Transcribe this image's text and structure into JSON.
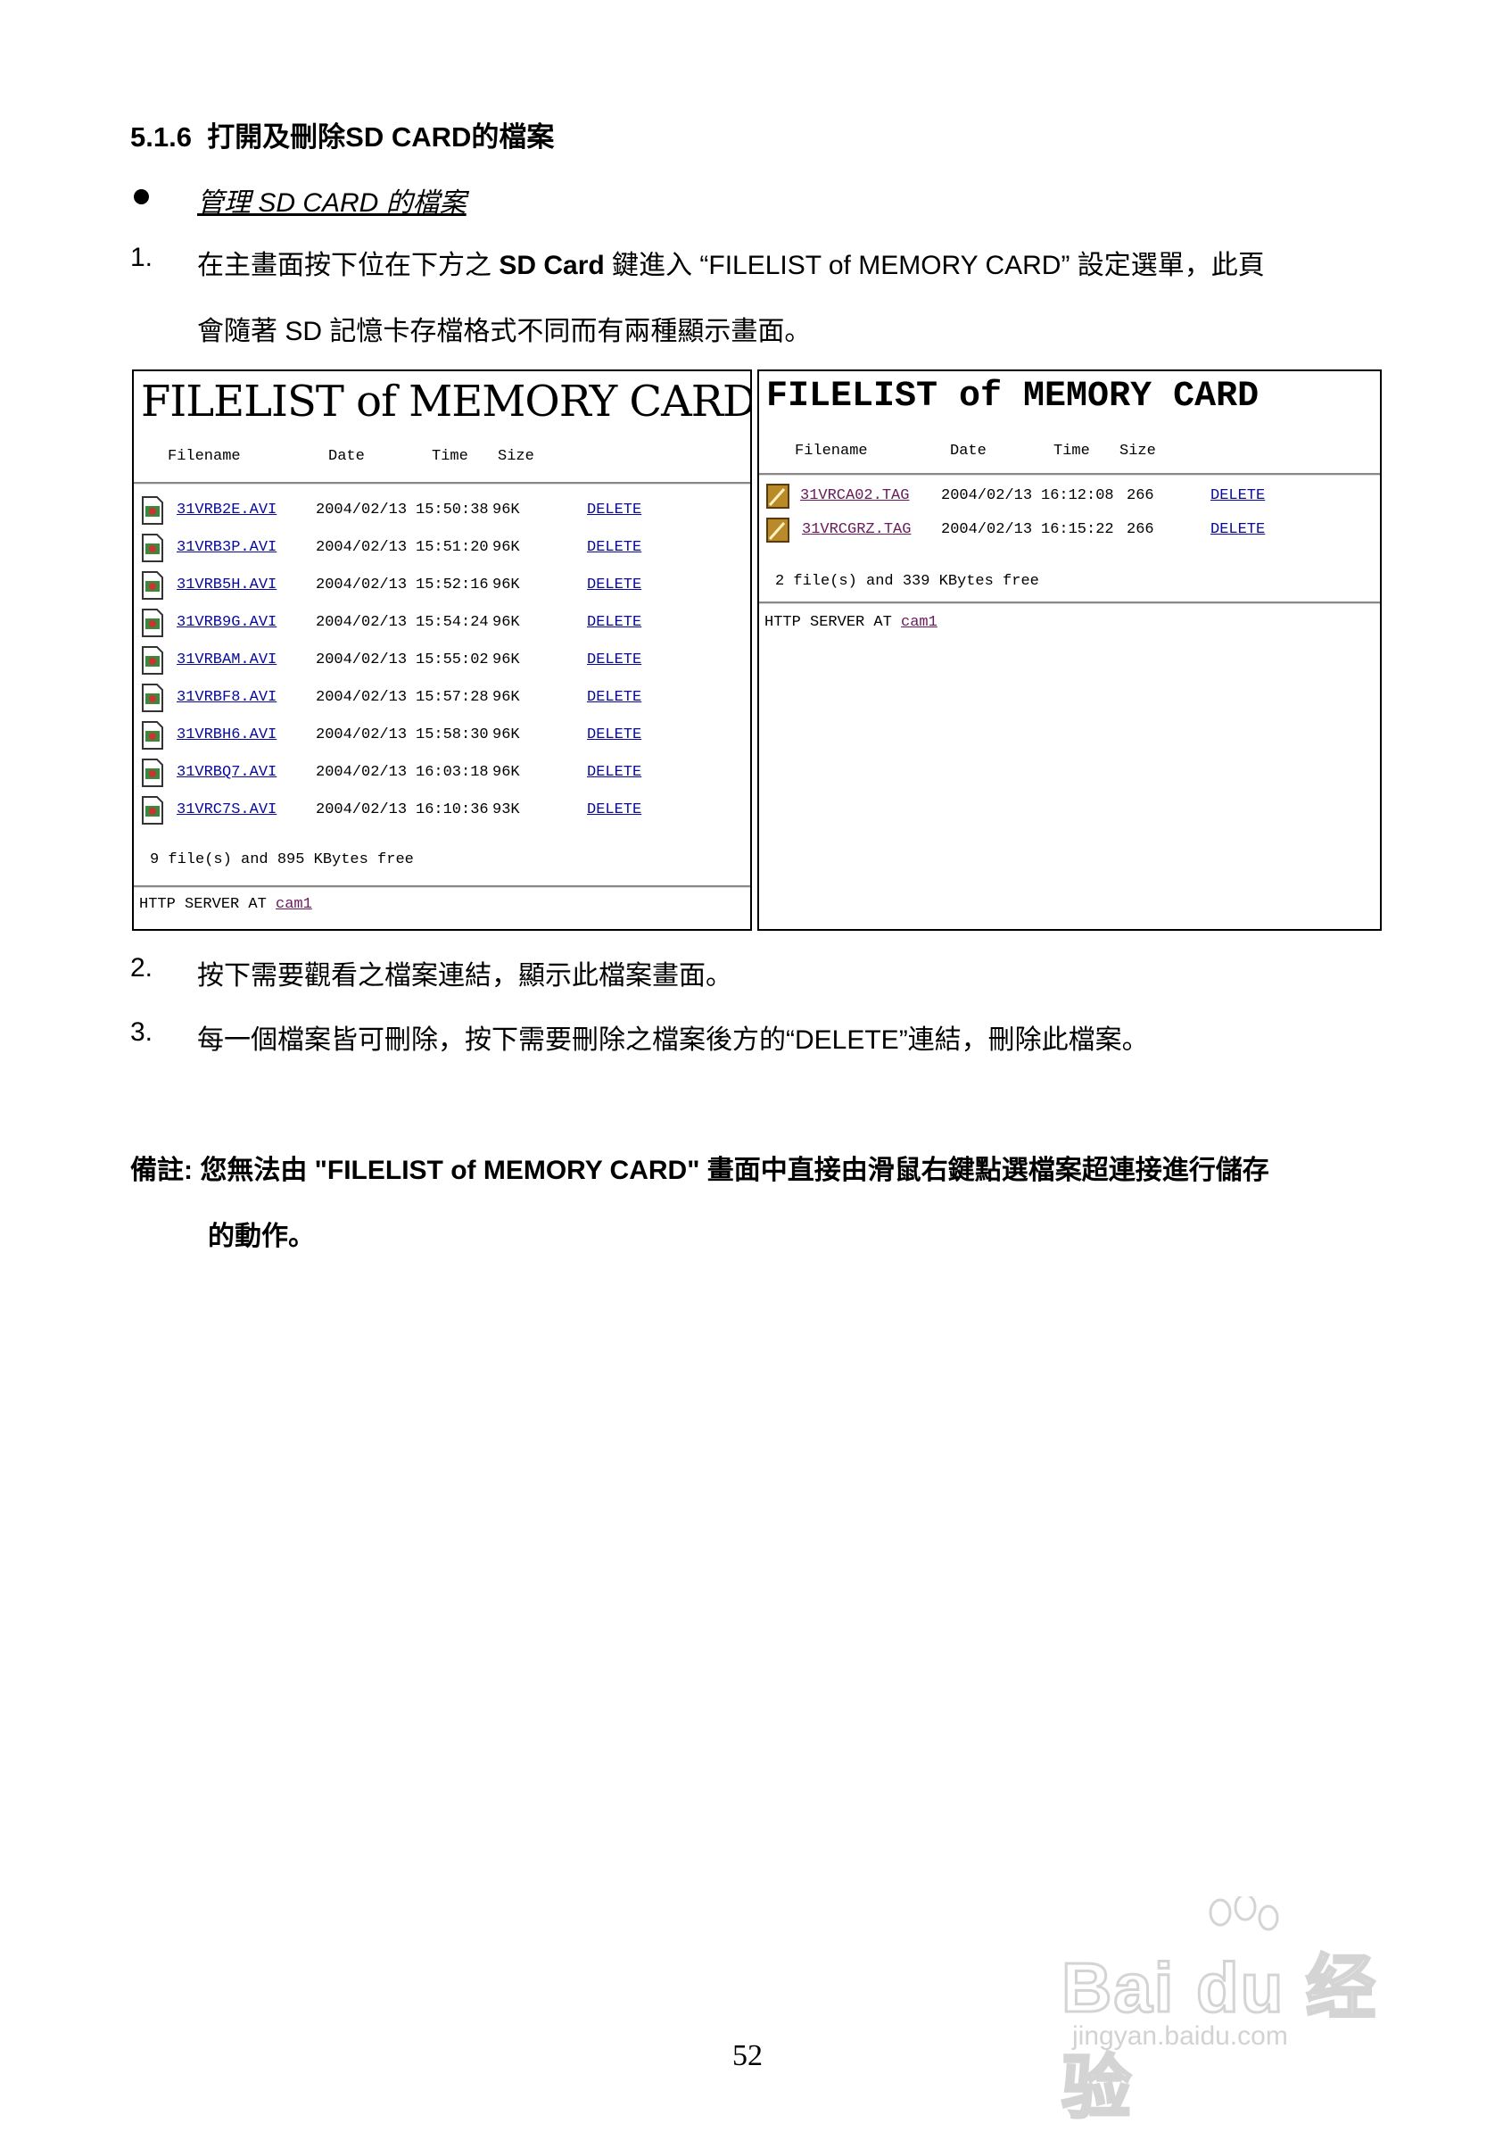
{
  "section": {
    "number": "5.1.6",
    "title": "打開及刪除SD CARD的檔案"
  },
  "bullet": "管理 SD CARD 的檔案",
  "steps": [
    {
      "num": "1.",
      "pre": "在主畫面按下位在下方之 ",
      "bold": "SD Card",
      "post": " 鍵進入 “FILELIST of MEMORY CARD” 設定選單，此頁",
      "line2": "會隨著 SD 記憶卡存檔格式不同而有兩種顯示畫面。"
    },
    {
      "num": "2.",
      "text": "按下需要觀看之檔案連結，顯示此檔案畫面。"
    },
    {
      "num": "3.",
      "text": "每一個檔案皆可刪除，按下需要刪除之檔案後方的“DELETE”連結，刪除此檔案。"
    }
  ],
  "panel_left": {
    "title": "FILELIST of MEMORY CARD",
    "headers": {
      "filename": "Filename",
      "date": "Date",
      "time": "Time",
      "size": "Size"
    },
    "rows": [
      {
        "name": "31VRB2E.AVI",
        "date": "2004/02/13",
        "time": "15:50:38",
        "size": "96K",
        "action": "DELETE"
      },
      {
        "name": "31VRB3P.AVI",
        "date": "2004/02/13",
        "time": "15:51:20",
        "size": "96K",
        "action": "DELETE"
      },
      {
        "name": "31VRB5H.AVI",
        "date": "2004/02/13",
        "time": "15:52:16",
        "size": "96K",
        "action": "DELETE"
      },
      {
        "name": "31VRB9G.AVI",
        "date": "2004/02/13",
        "time": "15:54:24",
        "size": "96K",
        "action": "DELETE"
      },
      {
        "name": "31VRBAM.AVI",
        "date": "2004/02/13",
        "time": "15:55:02",
        "size": "96K",
        "action": "DELETE"
      },
      {
        "name": "31VRBF8.AVI",
        "date": "2004/02/13",
        "time": "15:57:28",
        "size": "96K",
        "action": "DELETE"
      },
      {
        "name": "31VRBH6.AVI",
        "date": "2004/02/13",
        "time": "15:58:30",
        "size": "96K",
        "action": "DELETE"
      },
      {
        "name": "31VRBQ7.AVI",
        "date": "2004/02/13",
        "time": "16:03:18",
        "size": "96K",
        "action": "DELETE"
      },
      {
        "name": "31VRC7S.AVI",
        "date": "2004/02/13",
        "time": "16:10:36",
        "size": "93K",
        "action": "DELETE"
      }
    ],
    "summary": "9 file(s) and 895 KBytes free",
    "server_prefix": "HTTP SERVER AT ",
    "server_link": "cam1"
  },
  "panel_right": {
    "title": "FILELIST of MEMORY CARD",
    "headers": {
      "filename": "Filename",
      "date": "Date",
      "time": "Time",
      "size": "Size"
    },
    "rows": [
      {
        "name": "31VRCA02.TAG",
        "date": "2004/02/13",
        "time": "16:12:08",
        "size": "266",
        "action": "DELETE"
      },
      {
        "name": "31VRCGRZ.TAG",
        "date": "2004/02/13",
        "time": "16:15:22",
        "size": "266",
        "action": "DELETE"
      }
    ],
    "summary": "2 file(s) and 339 KBytes free",
    "server_prefix": "HTTP SERVER AT ",
    "server_link": "cam1"
  },
  "note": {
    "label": "備註: 您無法由 \"FILELIST of MEMORY CARD\" 畫面中直接由滑鼠右鍵點選檔案超連接進行儲存",
    "line2": "的動作。"
  },
  "page_number": "52",
  "watermark": {
    "main": "Bai du 经验",
    "sub": "jingyan.baidu.com"
  }
}
